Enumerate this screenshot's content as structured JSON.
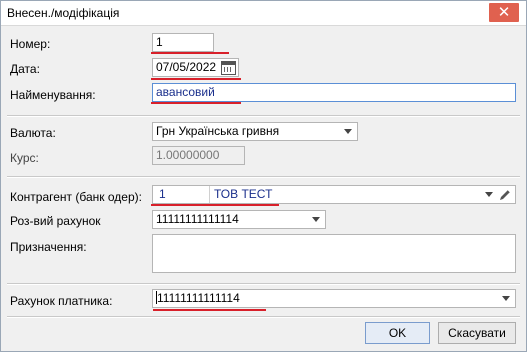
{
  "window": {
    "title": "Внесен./модіфікація",
    "close_glyph": "✕"
  },
  "form": {
    "number": {
      "label": "Номер:",
      "value": "1"
    },
    "date": {
      "label": "Дата:",
      "value": "07/05/2022"
    },
    "name": {
      "label": "Найменування:",
      "value": "авансовий"
    },
    "currency": {
      "label": "Валюта:",
      "value": "Грн Українська гривня"
    },
    "rate": {
      "label": "Курс:",
      "value": "1.00000000"
    },
    "counterparty": {
      "label": "Контрагент (банк одер):",
      "code": "1",
      "name": "ТОВ ТЕСТ"
    },
    "settlement_account": {
      "label": "Роз-вий рахунок",
      "value": "11111111111114"
    },
    "purpose": {
      "label": "Призначення:",
      "value": ""
    },
    "payer_account": {
      "label": "Рахунок платника:",
      "value": "11111111111114"
    }
  },
  "buttons": {
    "ok": "OK",
    "cancel": "Скасувати"
  },
  "colors": {
    "annotation_red": "#d8202a",
    "close_button": "#e0614f",
    "value_blue": "#1a2f8c"
  }
}
